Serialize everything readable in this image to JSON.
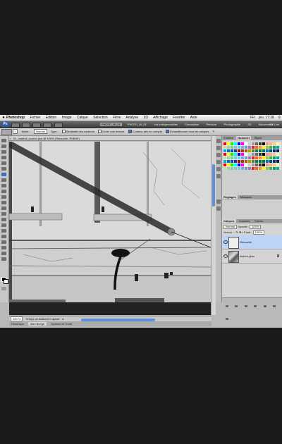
{
  "menubar": {
    "apple": "",
    "app_name": "Photoshop",
    "items": [
      "Fichier",
      "Edition",
      "Image",
      "Calque",
      "Sélection",
      "Filtre",
      "Analyse",
      "3D",
      "Affichage",
      "Fenêtre",
      "Aide"
    ],
    "clock": "jeu. 17:28",
    "flag": "FR"
  },
  "appbar": {
    "logo": "Ps",
    "workspaces": [
      "PHOTO_W_01",
      "PHOTO_W_02",
      "Les indispensables",
      "Conception",
      "Peinture",
      "Photographie",
      "3D",
      "Mouvement"
    ],
    "cs_live": "CS Live"
  },
  "options": {
    "mode_label": "Mode :",
    "mode_value": "Normal",
    "type_label": "Type :",
    "toggle1": "Similarité des couleurs",
    "toggle2": "Créer une texture",
    "toggle3": "Contenu pris en compte",
    "toggle4": "Échantillonner tous les calques"
  },
  "doc": {
    "tab_title": "01_cadeuil_source.psd @ 100% (Retouche, RVB/8*)"
  },
  "status": {
    "zoom": "100 %",
    "info": "Temps de traitement ajusté",
    "arrow": "▸"
  },
  "bottom_tabs": [
    "Historique",
    "Mini Bridge",
    "Options de l'outil"
  ],
  "panels": {
    "color_tabs": [
      "Couleur",
      "Nuancier",
      "Styles"
    ],
    "adjust_tabs": [
      "Réglages",
      "Masques"
    ],
    "layer_tabs": [
      "Calques",
      "Couches",
      "Tracés"
    ],
    "blend_mode": "Normal",
    "opacity_label": "Opacité :",
    "opacity_value": "100%",
    "lock_label": "Verrou :",
    "fill_label": "Fond :",
    "fill_value": "100%"
  },
  "layers": [
    {
      "name": "Retouche",
      "selected": true
    },
    {
      "name": "Arrière-plan",
      "selected": false
    }
  ],
  "colors": {
    "selection": "#bcd4f7",
    "scroll_thumb": "#5f8fd9",
    "annotation_arrow": "#e21b1b"
  }
}
